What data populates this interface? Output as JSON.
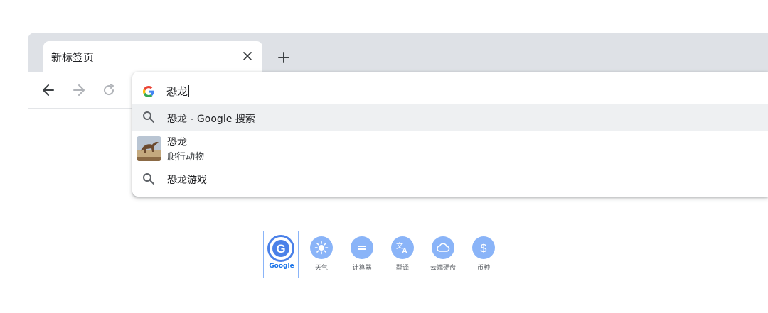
{
  "tab": {
    "title": "新标签页"
  },
  "omnibox": {
    "query": "恐龙",
    "suggestions": [
      {
        "type": "search",
        "text": "恐龙 - Google 搜索"
      },
      {
        "type": "entity",
        "title": "恐龙",
        "subtitle": "爬行动物"
      },
      {
        "type": "search",
        "text": "恐龙游戏"
      }
    ]
  },
  "shortcuts": [
    {
      "label": "Google",
      "icon": "google-icon"
    },
    {
      "label": "天气",
      "icon": "weather-sun-icon"
    },
    {
      "label": "计算器",
      "icon": "calculator-icon"
    },
    {
      "label": "翻译",
      "icon": "translate-icon"
    },
    {
      "label": "云端硬盘",
      "icon": "cloud-icon"
    },
    {
      "label": "币种",
      "icon": "dollar-icon"
    }
  ],
  "colors": {
    "tabstrip": "#dee1e6",
    "accent": "#8ab4f8",
    "active_label": "#1a73e8"
  }
}
